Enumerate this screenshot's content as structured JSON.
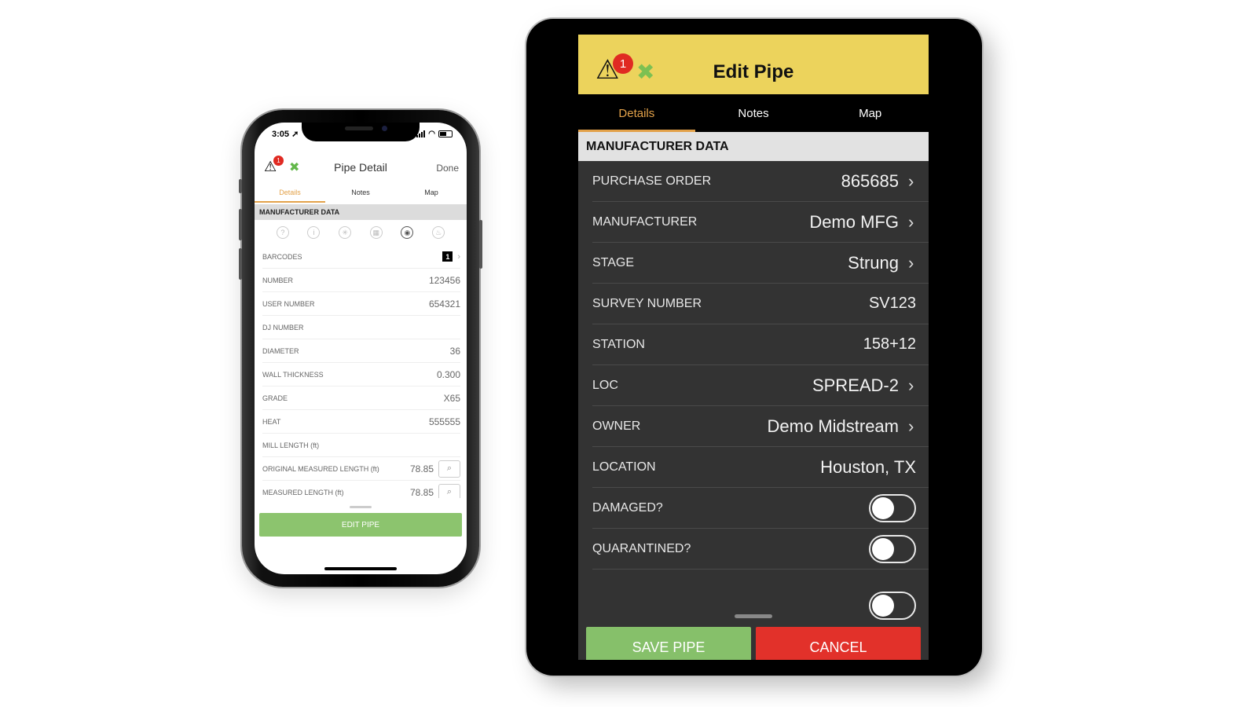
{
  "phone": {
    "status": {
      "time": "3:05"
    },
    "header": {
      "alert_count": "1",
      "title": "Pipe Detail",
      "done_label": "Done"
    },
    "tabs": [
      {
        "label": "Details",
        "active": true
      },
      {
        "label": "Notes",
        "active": false
      },
      {
        "label": "Map",
        "active": false
      }
    ],
    "section_title": "MANUFACTURER DATA",
    "icon_row": [
      "help-icon",
      "info-icon",
      "weld-icon",
      "coating-icon",
      "camera-icon",
      "inspection-icon"
    ],
    "rows": [
      {
        "label": "BARCODES",
        "value": "1",
        "kind": "badge"
      },
      {
        "label": "NUMBER",
        "value": "123456"
      },
      {
        "label": "USER NUMBER",
        "value": "654321"
      },
      {
        "label": "DJ NUMBER",
        "value": ""
      },
      {
        "label": "DIAMETER",
        "value": "36"
      },
      {
        "label": "WALL THICKNESS",
        "value": "0.300"
      },
      {
        "label": "GRADE",
        "value": "X65"
      },
      {
        "label": "HEAT",
        "value": "555555"
      },
      {
        "label": "MILL LENGTH (ft)",
        "value": ""
      },
      {
        "label": "ORIGINAL MEASURED LENGTH (ft)",
        "value": "78.85",
        "kind": "measure"
      },
      {
        "label": "MEASURED LENGTH (ft)",
        "value": "78.85",
        "kind": "measure"
      }
    ],
    "edit_label": "EDIT PIPE"
  },
  "tablet": {
    "header": {
      "alert_count": "1",
      "title": "Edit Pipe"
    },
    "tabs": [
      {
        "label": "Details",
        "active": true
      },
      {
        "label": "Notes",
        "active": false
      },
      {
        "label": "Map",
        "active": false
      }
    ],
    "section_title": "MANUFACTURER DATA",
    "rows": [
      {
        "label": "PURCHASE ORDER",
        "value": "865685",
        "chevron": true
      },
      {
        "label": "MANUFACTURER",
        "value": "Demo MFG",
        "chevron": true
      },
      {
        "label": "STAGE",
        "value": "Strung",
        "chevron": true
      },
      {
        "label": "SURVEY NUMBER",
        "value": "SV123",
        "chevron": false
      },
      {
        "label": "STATION",
        "value": "158+12",
        "chevron": false
      },
      {
        "label": "LOC",
        "value": "SPREAD-2",
        "chevron": true
      },
      {
        "label": "OWNER",
        "value": "Demo Midstream",
        "chevron": true
      },
      {
        "label": "LOCATION",
        "value": "Houston, TX",
        "chevron": false
      }
    ],
    "toggles": [
      {
        "label": "DAMAGED?",
        "on": false
      },
      {
        "label": "QUARANTINED?",
        "on": false
      }
    ],
    "save_label": "SAVE PIPE",
    "cancel_label": "CANCEL"
  },
  "colors": {
    "accent_orange": "#e3a24a",
    "header_yellow": "#ecd35c",
    "save_green": "#86c06a",
    "cancel_red": "#e2312a",
    "alert_red": "#e02a22"
  }
}
